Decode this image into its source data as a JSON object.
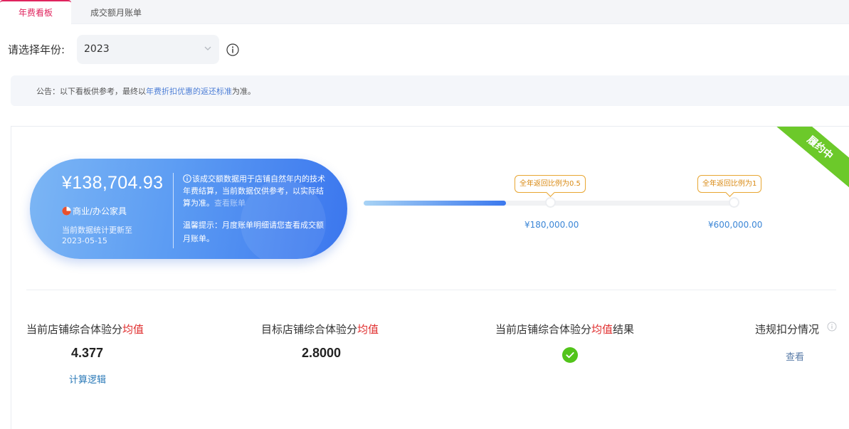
{
  "tabs": [
    {
      "label": "年费看板",
      "active": true
    },
    {
      "label": "成交额月账单",
      "active": false
    }
  ],
  "year_select": {
    "label": "请选择年份:",
    "value": "2023"
  },
  "notice": {
    "prefix": "公告：以下看板供参考，最终以",
    "link": "年费折扣优惠的返还标准",
    "suffix": "为准。"
  },
  "status_ribbon": "履约中",
  "summary": {
    "amount": "¥138,704.93",
    "category": "商业/办公家具",
    "update_line1": "当前数据统计更新至",
    "update_line2": "2023-05-15",
    "desc": "该成交额数据用于店铺自然年内的技术年费结算，当前数据仅供参考，以实际结算为准。",
    "desc_link": "查看账单",
    "tip": "温馨提示：月度账单明细请您查看成交额月账单。"
  },
  "progress": {
    "current_fraction": 0.38,
    "milestones": [
      {
        "label": "全年返回比例为0.5",
        "value": "¥180,000.00"
      },
      {
        "label": "全年返回比例为1",
        "value": "¥600,000.00"
      }
    ]
  },
  "metrics": {
    "current": {
      "label_prefix": "当前店铺综合体验分",
      "label_highlight": "均值",
      "label_suffix": "",
      "value": "4.377",
      "link": "计算逻辑"
    },
    "target": {
      "label_prefix": "目标店铺综合体验分",
      "label_highlight": "均值",
      "label_suffix": "",
      "value": "2.8000"
    },
    "result": {
      "label_prefix": "当前店铺综合体验分",
      "label_highlight": "均值",
      "label_suffix": "结果",
      "status": "check-icon"
    },
    "violation": {
      "label": "违规扣分情况",
      "link": "查看"
    }
  },
  "colors": {
    "accent_tab": "#e0245e",
    "ribbon": "#6cc92a",
    "highlight_red": "#e02e2e",
    "milestone": "#e8a632",
    "link_blue": "#3b86d6",
    "success_green": "#52c41a"
  }
}
